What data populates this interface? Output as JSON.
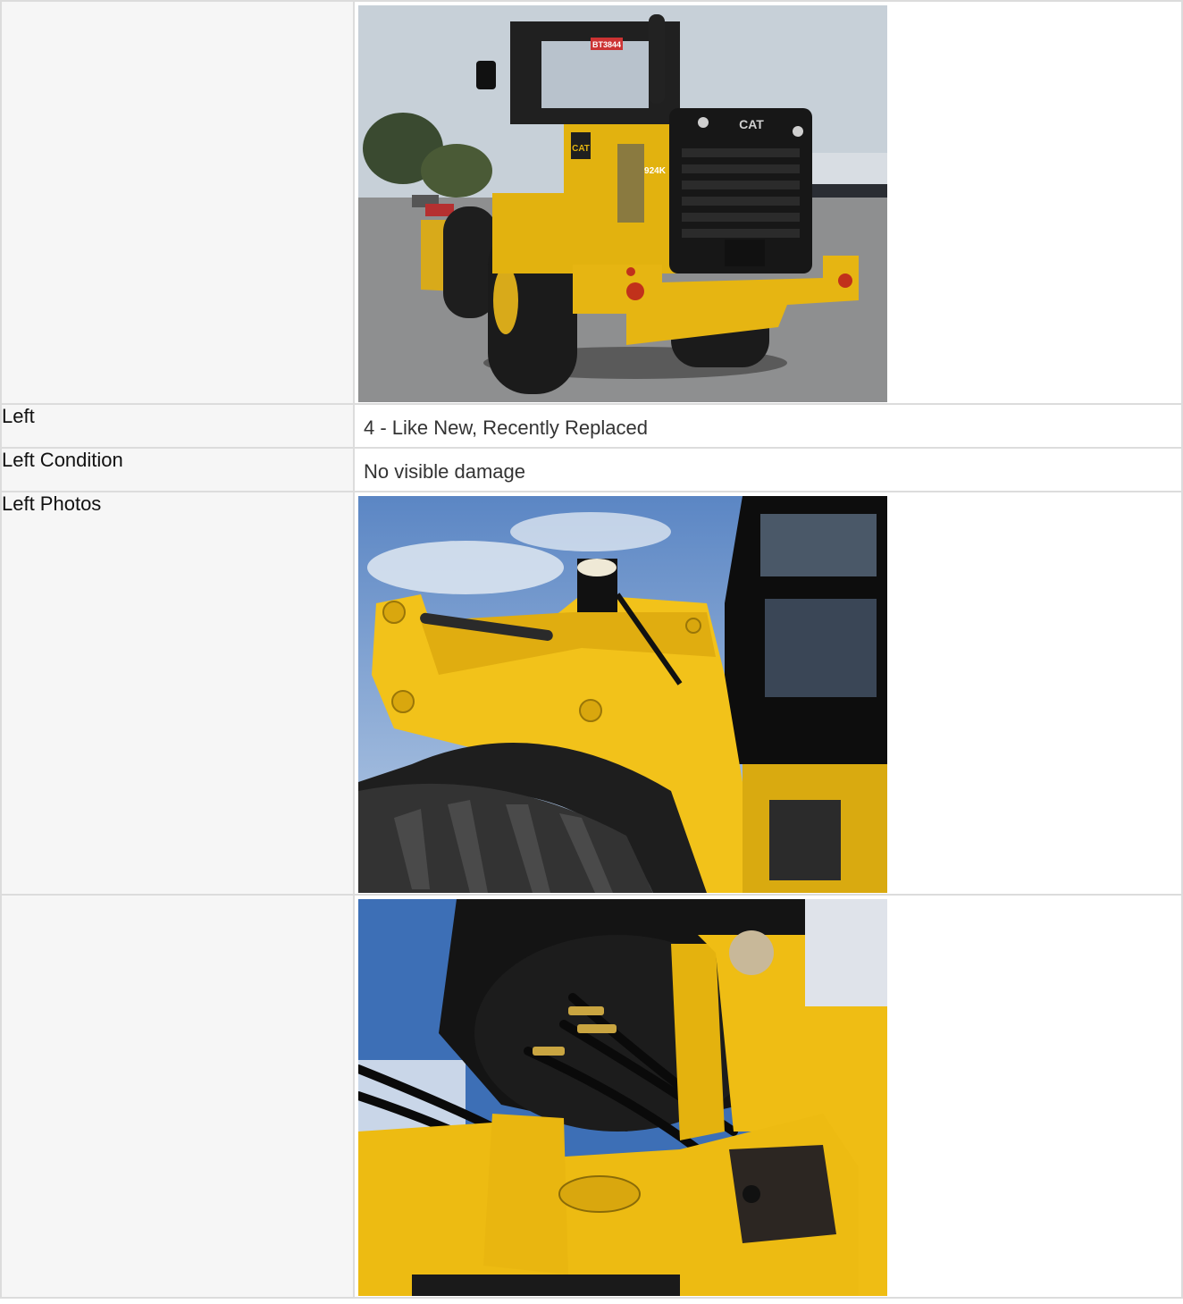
{
  "rows": [
    {
      "label": "",
      "type": "photo",
      "photo": "loader-rear-view-photo"
    },
    {
      "label": "Left",
      "type": "text",
      "value": "4 - Like New, Recently Replaced"
    },
    {
      "label": "Left Condition",
      "type": "text",
      "value": "No visible damage"
    },
    {
      "label": "Left Photos",
      "type": "photo",
      "photo": "loader-left-arm-photo"
    },
    {
      "label": "",
      "type": "photo",
      "photo": "loader-underside-hoses-photo"
    }
  ],
  "photo1": {
    "plate_text": "BT3844",
    "brand_text": "CAT",
    "model_text": "924K"
  },
  "colors": {
    "cat_yellow": "#e8b60f",
    "sky": "#c9d2da",
    "label_bg": "#f6f6f6",
    "border": "#dcdcdc"
  }
}
